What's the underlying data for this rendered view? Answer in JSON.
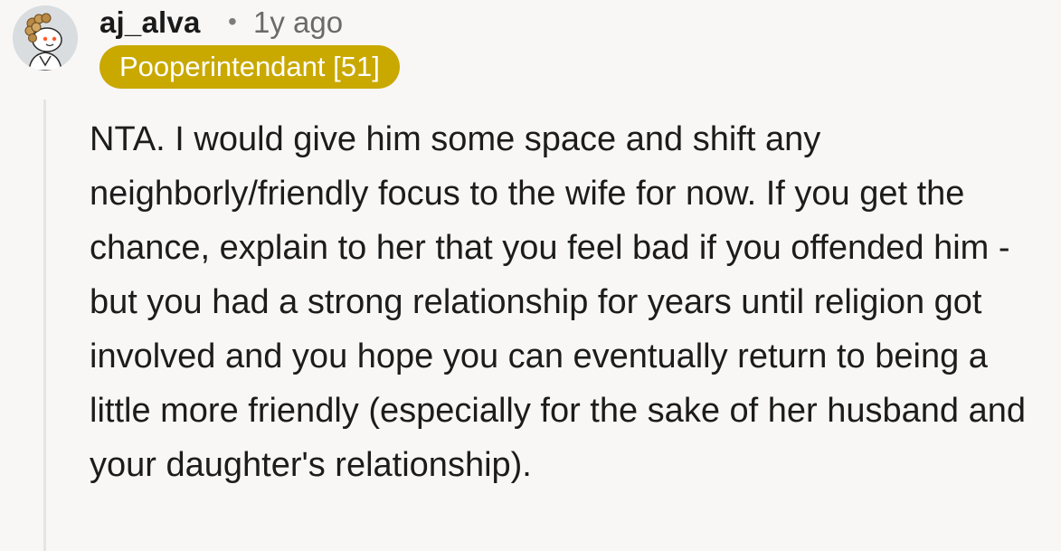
{
  "comment": {
    "author": "aj_alva",
    "separator": "•",
    "age": "1y ago",
    "flair": "Pooperintendant [51]",
    "flair_color": "#c9a800",
    "avatar_icon": "snoo-avatar-icon",
    "body": "NTA. I would give him some space and shift any neighborly/friendly focus to the wife for now. If you get the chance, explain to her that you feel bad if you offended him - but you had a strong relationship for years until religion got involved and you hope you can eventually return to being a little more friendly (especially for the sake of her husband and your daughter's relationship)."
  }
}
